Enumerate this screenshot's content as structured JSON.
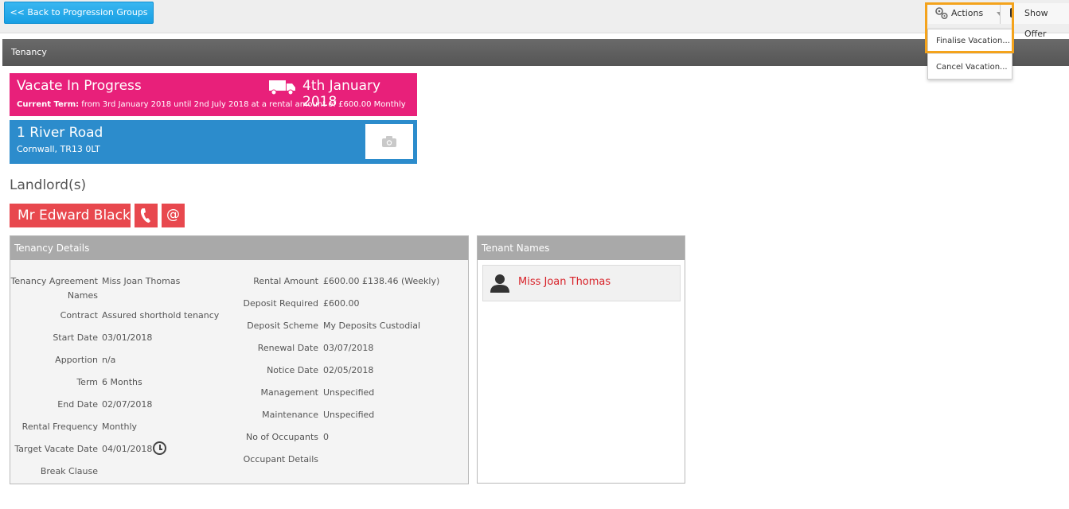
{
  "topbar": {
    "back_label": "<< Back to Progression Groups",
    "actions_label": "Actions",
    "show_offer_label": "Show Offer"
  },
  "actions_menu": {
    "items": [
      {
        "label": "Finalise Vacation..."
      },
      {
        "label": "Cancel Vacation..."
      }
    ]
  },
  "section": {
    "title": "Tenancy"
  },
  "status": {
    "title": "Vacate In Progress",
    "date": "4th January 2018",
    "term_label": "Current Term:",
    "term_text": " from 3rd January 2018 until 2nd July 2018 at a rental amount of £600.00 Monthly",
    "color": "#e8207a"
  },
  "property": {
    "street": "1 River Road",
    "town": "Cornwall, TR13 0LT",
    "color": "#2c8ccc"
  },
  "landlords": {
    "heading": "Landlord(s)",
    "name": "Mr Edward Black",
    "email_glyph": "@",
    "color": "#e8484e"
  },
  "tenancy_details": {
    "title": "Tenancy Details",
    "left": [
      {
        "key": "Tenancy Agreement",
        "key2": "Names",
        "value": "Miss Joan Thomas"
      },
      {
        "key": "Contract",
        "value": "Assured shorthold tenancy"
      },
      {
        "key": "Start Date",
        "value": "03/01/2018"
      },
      {
        "key": "Apportion",
        "value": "n/a"
      },
      {
        "key": "Term",
        "value": "6 Months"
      },
      {
        "key": "End Date",
        "value": "02/07/2018"
      },
      {
        "key": "Rental Frequency",
        "value": "Monthly"
      },
      {
        "key": "Target Vacate Date",
        "value": "04/01/2018"
      },
      {
        "key": "Break Clause",
        "value": ""
      }
    ],
    "right": [
      {
        "key": "Rental Amount",
        "value": "£600.00",
        "extra": "£138.46 (Weekly)"
      },
      {
        "key": "Deposit Required",
        "value": "£600.00"
      },
      {
        "key": "Deposit Scheme",
        "value": "My Deposits Custodial"
      },
      {
        "key": "Renewal Date",
        "value": "03/07/2018"
      },
      {
        "key": "Notice Date",
        "value": "02/05/2018"
      },
      {
        "key": "Management",
        "value": "Unspecified"
      },
      {
        "key": "Maintenance",
        "value": "Unspecified"
      },
      {
        "key": "No of Occupants",
        "value": "0"
      },
      {
        "key": "Occupant Details",
        "value": ""
      }
    ]
  },
  "tenant_names": {
    "title": "Tenant Names",
    "items": [
      {
        "name": "Miss Joan Thomas"
      }
    ]
  }
}
